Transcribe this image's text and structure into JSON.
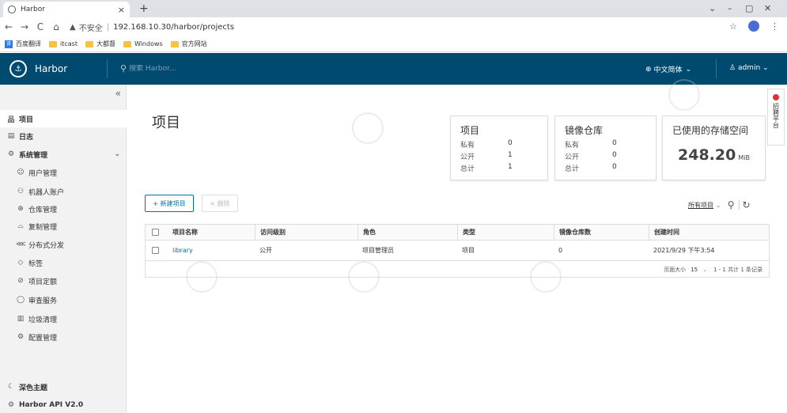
{
  "browser": {
    "tab_title": "Harbor",
    "tab_close": "×",
    "new_tab": "+",
    "window_controls": [
      "⌄",
      "–",
      "▢",
      "✕"
    ],
    "nav": [
      "←",
      "→",
      "C",
      "⌂"
    ],
    "security_label": "不安全",
    "url_sep": "|",
    "url": "192.168.10.30/harbor/projects",
    "bookmarks": [
      {
        "label": "百度翻译",
        "icon": "fanyi-icon"
      },
      {
        "label": "itcast",
        "icon": "folder-icon"
      },
      {
        "label": "大都督",
        "icon": "folder-icon"
      },
      {
        "label": "Windows",
        "icon": "folder-icon"
      },
      {
        "label": "官方网站",
        "icon": "folder-icon"
      }
    ]
  },
  "header": {
    "brand": "Harbor",
    "search_placeholder": "搜索 Harbor...",
    "language": "中文简体",
    "user": "admin"
  },
  "sidebar": {
    "collapse": "«",
    "items": [
      {
        "label": "项目",
        "icon": "projects-icon",
        "glyph": "品",
        "level": "top",
        "active": true
      },
      {
        "label": "日志",
        "icon": "logs-icon",
        "glyph": "▤",
        "level": "top"
      },
      {
        "label": "系统管理",
        "icon": "admin-icon",
        "glyph": "⚙",
        "level": "top",
        "expandable": true
      },
      {
        "label": "用户管理",
        "icon": "users-icon",
        "glyph": "☺",
        "level": "sub"
      },
      {
        "label": "机器人账户",
        "icon": "robot-icon",
        "glyph": "⚇",
        "level": "sub"
      },
      {
        "label": "仓库管理",
        "icon": "registry-icon",
        "glyph": "⊕",
        "level": "sub"
      },
      {
        "label": "复制管理",
        "icon": "replication-icon",
        "glyph": "⌓",
        "level": "sub"
      },
      {
        "label": "分布式分发",
        "icon": "distribution-icon",
        "glyph": "⋘",
        "level": "sub"
      },
      {
        "label": "标签",
        "icon": "tag-icon",
        "glyph": "◇",
        "level": "sub"
      },
      {
        "label": "项目定额",
        "icon": "quota-icon",
        "glyph": "⊘",
        "level": "sub"
      },
      {
        "label": "审查服务",
        "icon": "shield-icon",
        "glyph": "◯",
        "level": "sub"
      },
      {
        "label": "垃圾清理",
        "icon": "trash-icon",
        "glyph": "▥",
        "level": "sub"
      },
      {
        "label": "配置管理",
        "icon": "config-icon",
        "glyph": "⚙",
        "level": "sub"
      },
      {
        "label": "深色主题",
        "icon": "moon-icon",
        "glyph": "☾",
        "level": "top"
      },
      {
        "label": "Harbor API V2.0",
        "icon": "api-icon",
        "glyph": "⚙",
        "level": "top"
      }
    ]
  },
  "main": {
    "title": "项目",
    "cards": {
      "projects": {
        "title": "项目",
        "rows": [
          {
            "label": "私有",
            "value": "0"
          },
          {
            "label": "公开",
            "value": "1"
          },
          {
            "label": "总计",
            "value": "1"
          }
        ]
      },
      "repos": {
        "title": "镜像仓库",
        "rows": [
          {
            "label": "私有",
            "value": "0"
          },
          {
            "label": "公开",
            "value": "0"
          },
          {
            "label": "总计",
            "value": "0"
          }
        ]
      },
      "storage": {
        "title": "已使用的存储空间",
        "value": "248.20",
        "unit": "MiB"
      }
    },
    "new_project": "+ 新建项目",
    "delete": "× 删除",
    "filter_label": "所有项目",
    "table": {
      "headers": [
        "项目名称",
        "访问级别",
        "角色",
        "类型",
        "镜像仓库数",
        "创建时间"
      ],
      "rows": [
        [
          "library",
          "公开",
          "项目管理员",
          "项目",
          "0",
          "2021/9/29 下午3:54"
        ]
      ]
    },
    "pagination": {
      "page_size_label": "页面大小",
      "page_size": "15",
      "summary": "1 - 1 共计 1 条记录"
    }
  },
  "feedback": {
    "text": "招聘平台"
  }
}
